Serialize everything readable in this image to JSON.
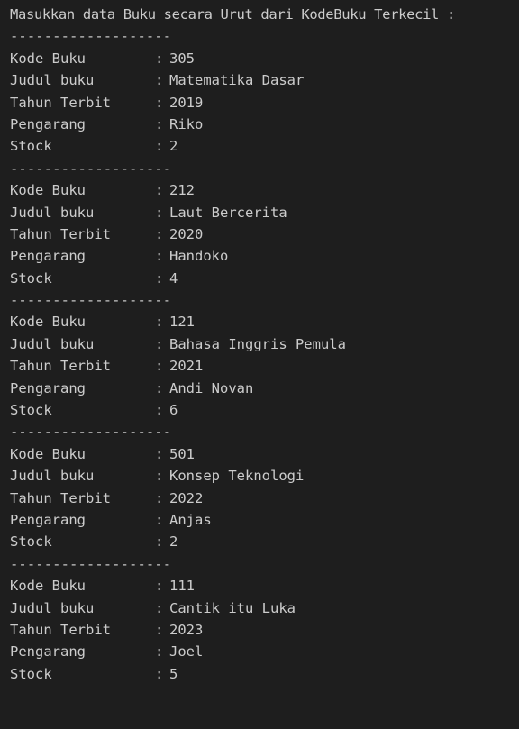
{
  "header": "Masukkan data Buku secara Urut dari KodeBuku Terkecil :",
  "separator": "-------------------",
  "colon": ":",
  "labels": {
    "kode": "Kode Buku",
    "judul": "Judul buku",
    "tahun": "Tahun Terbit",
    "pengarang": "Pengarang",
    "stock": "Stock"
  },
  "books": [
    {
      "kode": "305",
      "judul": "Matematika Dasar",
      "tahun": "2019",
      "pengarang": "Riko",
      "stock": "2"
    },
    {
      "kode": "212",
      "judul": "Laut Bercerita",
      "tahun": "2020",
      "pengarang": "Handoko",
      "stock": "4"
    },
    {
      "kode": "121",
      "judul": "Bahasa Inggris Pemula",
      "tahun": "2021",
      "pengarang": "Andi Novan",
      "stock": "6"
    },
    {
      "kode": "501",
      "judul": "Konsep Teknologi",
      "tahun": "2022",
      "pengarang": "Anjas",
      "stock": "2"
    },
    {
      "kode": "111",
      "judul": "Cantik itu Luka",
      "tahun": "2023",
      "pengarang": "Joel",
      "stock": "5"
    }
  ]
}
